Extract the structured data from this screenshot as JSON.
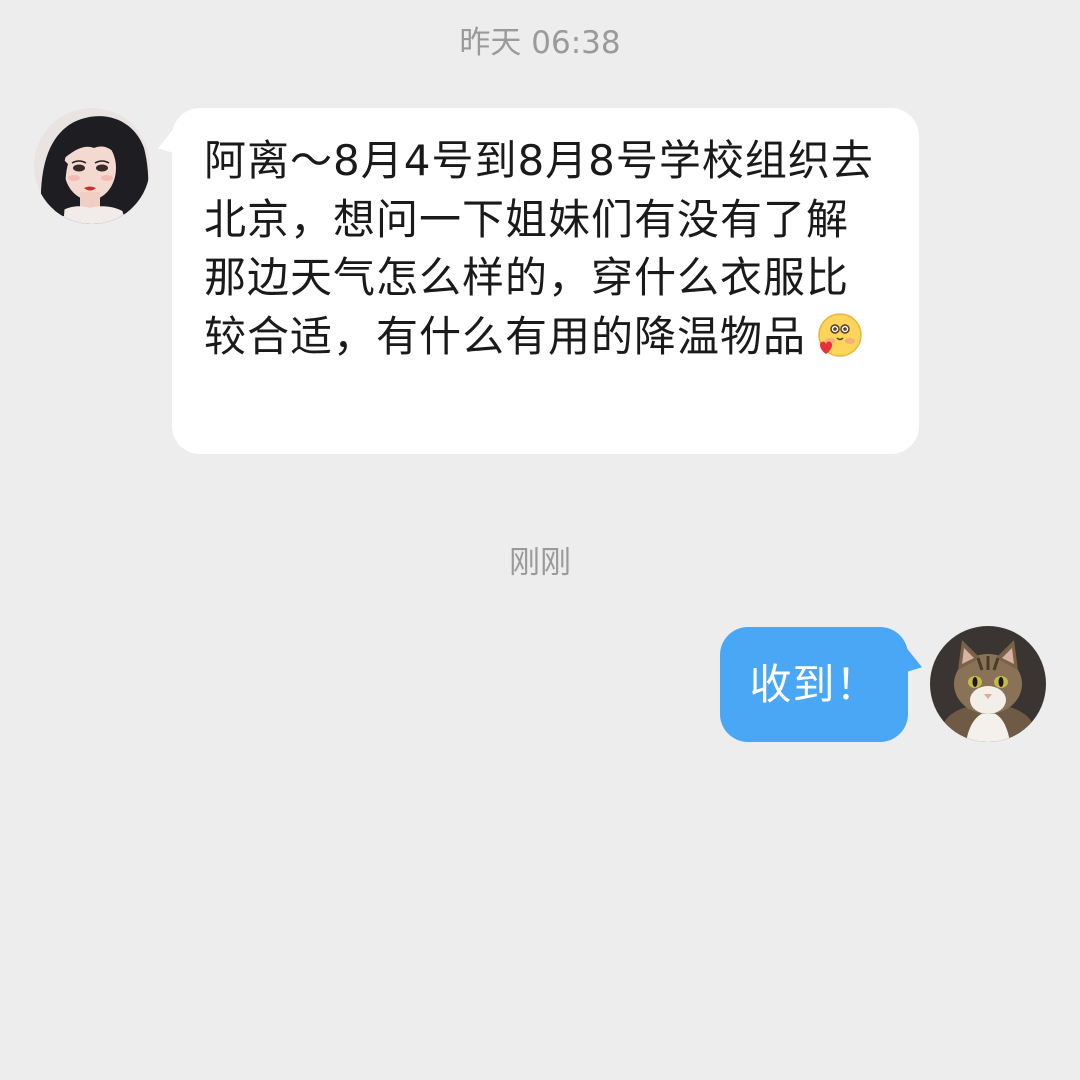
{
  "chat": {
    "timestamp_1": "昨天 06:38",
    "timestamp_2": "刚刚",
    "incoming": {
      "text": "阿离～8月4号到8月8号学校组织去北京，想问一下姐妹们有没有了解那边天气怎么样的，穿什么衣服比较合适，有什么有用的降温物品",
      "emoji": "blushing-face-with-heart-emoji"
    },
    "outgoing": {
      "text": "收到！"
    }
  },
  "colors": {
    "background": "#ededed",
    "incoming_bubble": "#ffffff",
    "outgoing_bubble": "#4aa7f5",
    "timestamp_text": "#9a9a9a"
  }
}
